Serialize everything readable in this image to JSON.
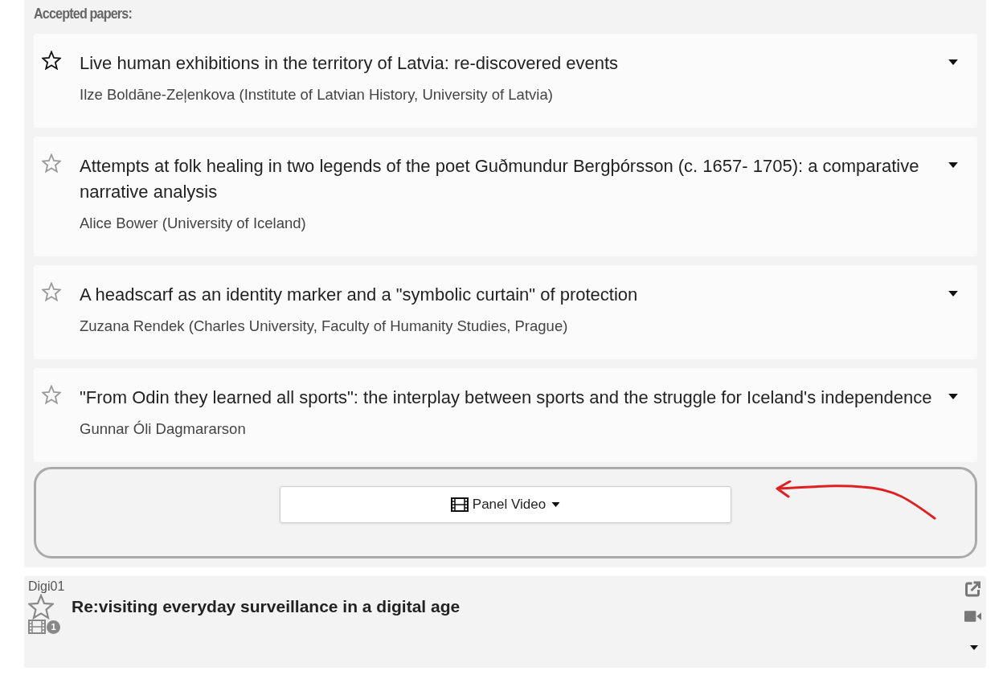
{
  "section_heading": "Accepted papers:",
  "papers": [
    {
      "title": "Live human exhibitions in the territory of Latvia: re-discovered events",
      "authors": "Ilze Boldāne-Zeļenkova (Institute of Latvian History, University of Latvia)",
      "highlighted": true
    },
    {
      "title": "Attempts at folk healing in two legends of the poet Guðmundur Bergþórsson (c. 1657- 1705): a comparative narrative analysis",
      "authors": "Alice Bower (University of Iceland)",
      "highlighted": false
    },
    {
      "title": "A headscarf as an identity marker and a \"symbolic curtain\" of protection",
      "authors": "Zuzana Rendek (Charles University, Faculty of Humanity Studies, Prague)",
      "highlighted": false
    },
    {
      "title": "\"From Odin they learned all sports\": the interplay between sports and the struggle for Iceland's independence",
      "authors": "Gunnar Óli Dagmararson",
      "highlighted": false
    }
  ],
  "panel_video_button": {
    "label": "Panel Video"
  },
  "next_panel": {
    "code": "Digi01",
    "title": "Re:visiting everyday surveillance in a digital age",
    "video_count": "1"
  }
}
